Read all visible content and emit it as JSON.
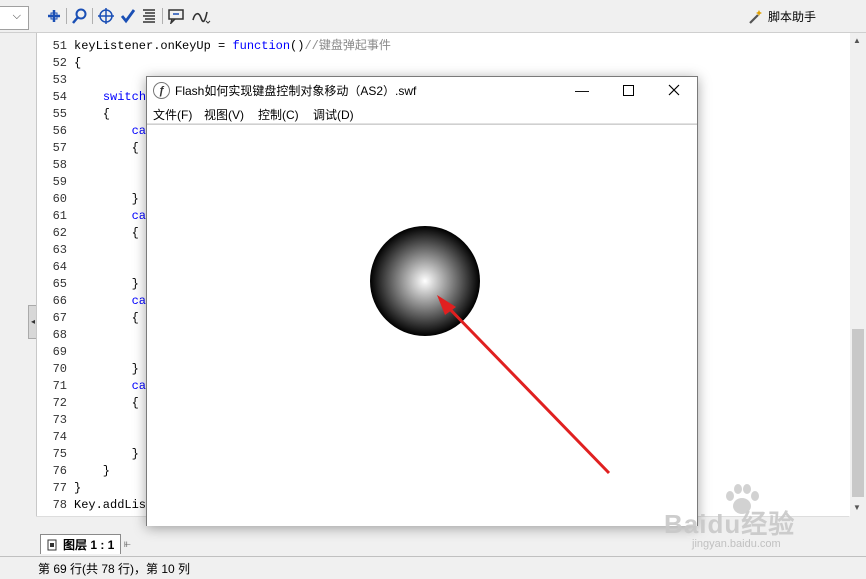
{
  "toolbar": {
    "assistant_label": "脚本助手"
  },
  "editor": {
    "lines": [
      {
        "num": "51",
        "plain": "keyListener.onKeyUp = ",
        "kw": "function",
        "rest": "()",
        "comment": "//键盘弹起事件"
      },
      {
        "num": "52",
        "plain": "{",
        "kw": "",
        "rest": "",
        "comment": ""
      },
      {
        "num": "53",
        "plain": "",
        "kw": "",
        "rest": "",
        "comment": ""
      },
      {
        "num": "54",
        "plain": "    ",
        "kw": "switch",
        "rest": "",
        "comment": ""
      },
      {
        "num": "55",
        "plain": "    {",
        "kw": "",
        "rest": "",
        "comment": ""
      },
      {
        "num": "56",
        "plain": "        ",
        "kw": "cas",
        "rest": "",
        "comment": ""
      },
      {
        "num": "57",
        "plain": "        {",
        "kw": "",
        "rest": "",
        "comment": ""
      },
      {
        "num": "58",
        "plain": "",
        "kw": "",
        "rest": "",
        "comment": ""
      },
      {
        "num": "59",
        "plain": "",
        "kw": "",
        "rest": "",
        "comment": ""
      },
      {
        "num": "60",
        "plain": "        }",
        "kw": "",
        "rest": "",
        "comment": ""
      },
      {
        "num": "61",
        "plain": "        ",
        "kw": "cas",
        "rest": "",
        "comment": ""
      },
      {
        "num": "62",
        "plain": "        {",
        "kw": "",
        "rest": "",
        "comment": ""
      },
      {
        "num": "63",
        "plain": "",
        "kw": "",
        "rest": "",
        "comment": ""
      },
      {
        "num": "64",
        "plain": "",
        "kw": "",
        "rest": "",
        "comment": ""
      },
      {
        "num": "65",
        "plain": "        }",
        "kw": "",
        "rest": "",
        "comment": ""
      },
      {
        "num": "66",
        "plain": "        ",
        "kw": "cas",
        "rest": "",
        "comment": ""
      },
      {
        "num": "67",
        "plain": "        {",
        "kw": "",
        "rest": "",
        "comment": ""
      },
      {
        "num": "68",
        "plain": "",
        "kw": "",
        "rest": "",
        "comment": ""
      },
      {
        "num": "69",
        "plain": "",
        "kw": "",
        "rest": "",
        "comment": ""
      },
      {
        "num": "70",
        "plain": "        }",
        "kw": "",
        "rest": "",
        "comment": ""
      },
      {
        "num": "71",
        "plain": "        ",
        "kw": "cas",
        "rest": "",
        "comment": ""
      },
      {
        "num": "72",
        "plain": "        {",
        "kw": "",
        "rest": "",
        "comment": ""
      },
      {
        "num": "73",
        "plain": "",
        "kw": "",
        "rest": "",
        "comment": ""
      },
      {
        "num": "74",
        "plain": "",
        "kw": "",
        "rest": "",
        "comment": ""
      },
      {
        "num": "75",
        "plain": "        }",
        "kw": "",
        "rest": "",
        "comment": ""
      },
      {
        "num": "76",
        "plain": "    }",
        "kw": "",
        "rest": "",
        "comment": ""
      },
      {
        "num": "77",
        "plain": "}",
        "kw": "",
        "rest": "",
        "comment": ""
      },
      {
        "num": "78",
        "plain": "Key.addList",
        "kw": "",
        "rest": "",
        "comment": ""
      }
    ]
  },
  "layer_tab": {
    "label": "图层 1 : 1"
  },
  "status": {
    "text": "第 69 行(共 78 行)，第 10 列"
  },
  "flash_window": {
    "title": "Flash如何实现键盘控制对象移动（AS2）.swf",
    "menu": [
      "文件(F)",
      "视图(V)",
      "控制(C)",
      "调试(D)"
    ],
    "ball_colors": {
      "center": "#ffffff",
      "edge": "#000000"
    },
    "arrow_color": "#e02020"
  },
  "watermark": {
    "brand": "Baidu经验",
    "url": "jingyan.baidu.com"
  }
}
